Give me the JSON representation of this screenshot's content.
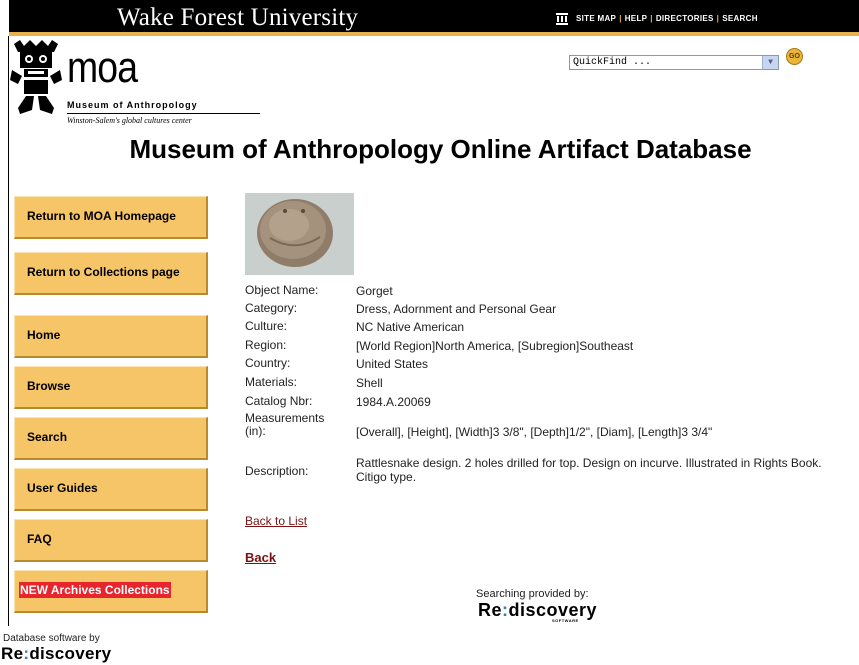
{
  "header": {
    "university": "Wake Forest University",
    "links": [
      "SITE MAP",
      "HELP",
      "DIRECTORIES",
      "SEARCH"
    ],
    "colors": {
      "bar": "#000000",
      "accent": "#e8b14a"
    }
  },
  "logo": {
    "wordmark": "moa",
    "museum": "Museum of Anthropology",
    "tagline": "Winston-Salem's global cultures center"
  },
  "quickfind": {
    "value": "QuickFind ...",
    "go_label": "GO"
  },
  "page_title": "Museum of Anthropology Online Artifact Database",
  "sidebar": {
    "items": [
      {
        "label": "Return to MOA Homepage"
      },
      {
        "label": "Return to Collections page"
      },
      {
        "label": "Home"
      },
      {
        "label": "Browse"
      },
      {
        "label": "Search"
      },
      {
        "label": "User Guides"
      },
      {
        "label": "FAQ"
      },
      {
        "label": "NEW Archives Collections"
      }
    ],
    "button_color": "#f6c567",
    "highlight_color": "#e8242c"
  },
  "artifact": {
    "fields": [
      {
        "label": "Object Name:",
        "value": "Gorget"
      },
      {
        "label": "Category:",
        "value": "Dress, Adornment and Personal Gear"
      },
      {
        "label": "Culture:",
        "value": "NC Native American"
      },
      {
        "label": "Region:",
        "value": "[World Region]North America, [Subregion]Southeast"
      },
      {
        "label": "Country:",
        "value": "United States"
      },
      {
        "label": "Materials:",
        "value": "Shell"
      },
      {
        "label": "Catalog Nbr:",
        "value": "1984.A.20069"
      },
      {
        "label": "Measurements (in):",
        "value": "[Overall], [Height], [Width]3 3/8\", [Depth]1/2\", [Diam], [Length]3 3/4\""
      },
      {
        "label": "Description:",
        "value": "Rattlesnake design. 2 holes drilled for top. Design on incurve. Illustrated in Rights Book. Citigo type."
      }
    ]
  },
  "links": {
    "back_to_list": "Back to List",
    "back": "Back"
  },
  "footer": {
    "searching": "Searching provided by:",
    "brand_re": "Re",
    "brand_colon": ":",
    "brand_rest": "discovery",
    "brand_software": "SOFTWARE",
    "db_software": "Database software by"
  }
}
